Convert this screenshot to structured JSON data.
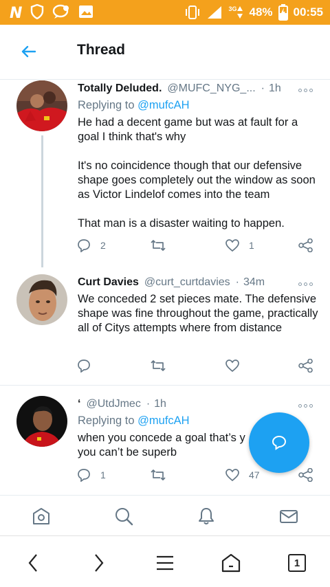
{
  "status_bar": {
    "logo": "N",
    "network": "3G",
    "battery": "48%",
    "time": "00:55",
    "background": "#f4a11c"
  },
  "header": {
    "back_icon": "arrow-left-icon",
    "title": "Thread"
  },
  "tweets": [
    {
      "name": "Totally Deluded.",
      "handle": "@MUFC_NYG_...",
      "separator": "·",
      "time": "1h",
      "replying_label": "Replying to",
      "replying_to": "@mufcAH",
      "body": [
        "He had a decent game but was at fault for a goal I think that's why",
        "It's no coincidence though that our defensive shape goes completely out the window as soon as Victor Lindelof comes into the team",
        "That man is a disaster waiting to happen."
      ],
      "replies": "2",
      "retweets": "",
      "likes": "1"
    },
    {
      "name": "Curt Davies",
      "handle": "@curt_curtdavies",
      "separator": "·",
      "time": "34m",
      "body": [
        "We conceded 2 set pieces mate. The defensive shape was fine throughout the game, practically all of Citys attempts where from distance"
      ],
      "replies": "",
      "retweets": "",
      "likes": ""
    },
    {
      "name": "‘",
      "handle": "@UtdJmec",
      "separator": "·",
      "time": "1h",
      "replying_label": "Replying to",
      "replying_to": "@mufcAH",
      "body": [
        "when you concede a goal that’s y",
        "you can’t be superb"
      ],
      "replies": "1",
      "retweets": "",
      "likes": "47"
    }
  ],
  "fab": {
    "icon": "compose-reply-icon",
    "color": "#1da1f2"
  },
  "tab_bar": [
    "home-icon",
    "search-icon",
    "notifications-bell-icon",
    "messages-mail-icon"
  ],
  "browser_bar": {
    "icons": [
      "back-chevron-icon",
      "forward-chevron-icon",
      "menu-icon",
      "home-icon",
      "tabs-icon"
    ],
    "tab_count": "1"
  },
  "colors": {
    "accent": "#1da1f2",
    "muted": "#657786",
    "text": "#14171a"
  }
}
